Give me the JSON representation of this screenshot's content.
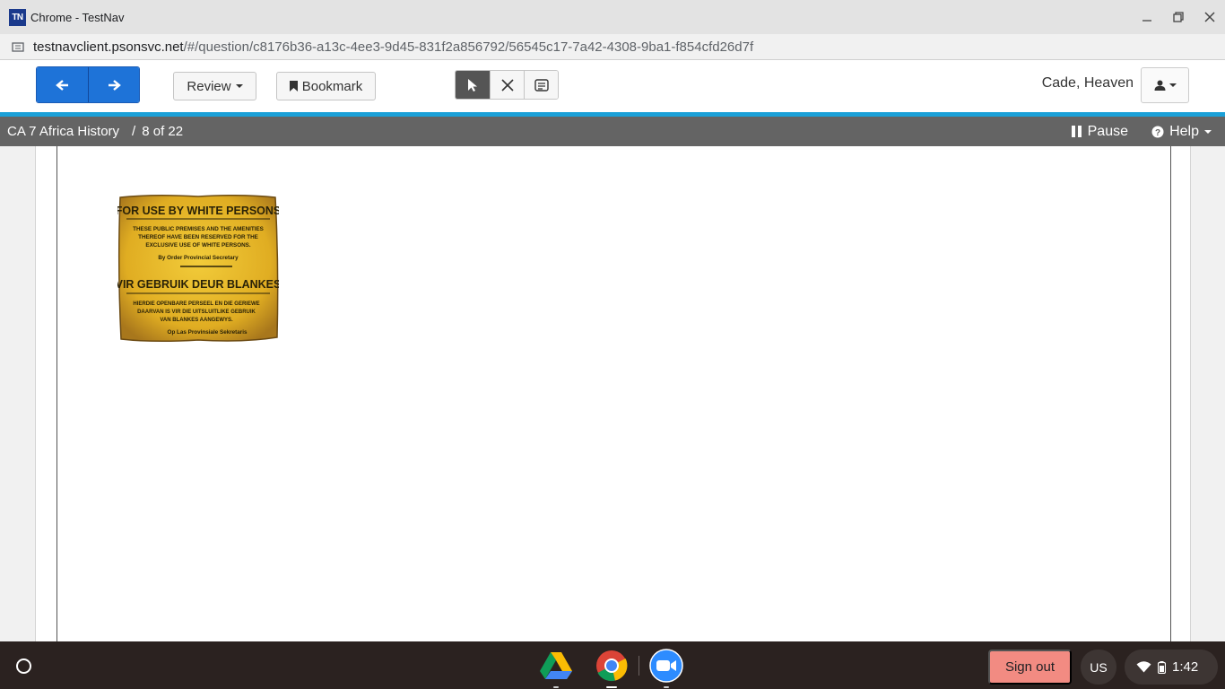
{
  "window": {
    "logo_text": "TN",
    "title": "Chrome - TestNav"
  },
  "address_bar": {
    "host": "testnavclient.psonsvc.net",
    "path": "/#/question/c8176b36-a13c-4ee3-9d45-831f2a856792/56545c17-7a42-4308-9ba1-f854cfd26d7f"
  },
  "toolbar": {
    "review_label": "Review",
    "bookmark_label": "Bookmark",
    "tools": [
      "pointer-icon",
      "eliminator-icon",
      "notepad-icon"
    ],
    "user_name": "Cade, Heaven"
  },
  "infobar": {
    "test_name": "CA 7 Africa History",
    "separator": "/",
    "progress": "8 of 22",
    "pause_label": "Pause",
    "help_label": "Help"
  },
  "question": {
    "sign_lines": [
      "FOR USE BY WHITE PERSONS",
      "THESE PUBLIC PREMISES AND THE AMENITIES",
      "THEREOF HAVE BEEN RESERVED FOR THE",
      "EXCLUSIVE USE OF WHITE PERSONS.",
      "By Order  Provincial Secretary",
      "VIR GEBRUIK DEUR BLANKES",
      "HIERDIE OPENBARE PERSEEL EN DIE GERIEWE",
      "DAARVAN IS VIR DIE UITSLUITLIKE GEBRUIK",
      "VAN BLANKES AANGEWYS.",
      "Op Las  Provinsiale Sekretaris"
    ]
  },
  "shelf": {
    "apps": [
      "google-drive-icon",
      "chrome-icon",
      "zoom-icon"
    ],
    "signout_label": "Sign out",
    "ime_label": "US",
    "time": "1:42"
  }
}
